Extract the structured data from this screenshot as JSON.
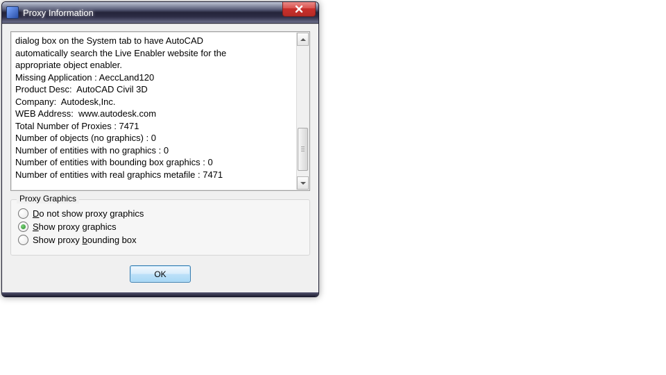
{
  "window": {
    "title": "Proxy Information"
  },
  "info": {
    "lines": [
      "dialog box on the System tab to have AutoCAD",
      "automatically search the Live Enabler website for the",
      "appropriate object enabler.",
      "",
      "Missing Application : AeccLand120",
      "Product Desc:  AutoCAD Civil 3D",
      "Company:  Autodesk,Inc.",
      "WEB Address:  www.autodesk.com",
      "Total Number of Proxies : 7471",
      "Number of objects (no graphics) : 0",
      "Number of entities with no graphics : 0",
      "Number of entities with bounding box graphics : 0",
      "Number of entities with real graphics metafile : 7471"
    ]
  },
  "group": {
    "legend": "Proxy Graphics",
    "options": [
      {
        "label": "Do not show proxy graphics",
        "hotkey_index": 0,
        "checked": false
      },
      {
        "label": "Show proxy graphics",
        "hotkey_index": 0,
        "checked": true
      },
      {
        "label": "Show proxy bounding box",
        "hotkey_index": 11,
        "checked": false
      }
    ]
  },
  "buttons": {
    "ok": "OK"
  }
}
